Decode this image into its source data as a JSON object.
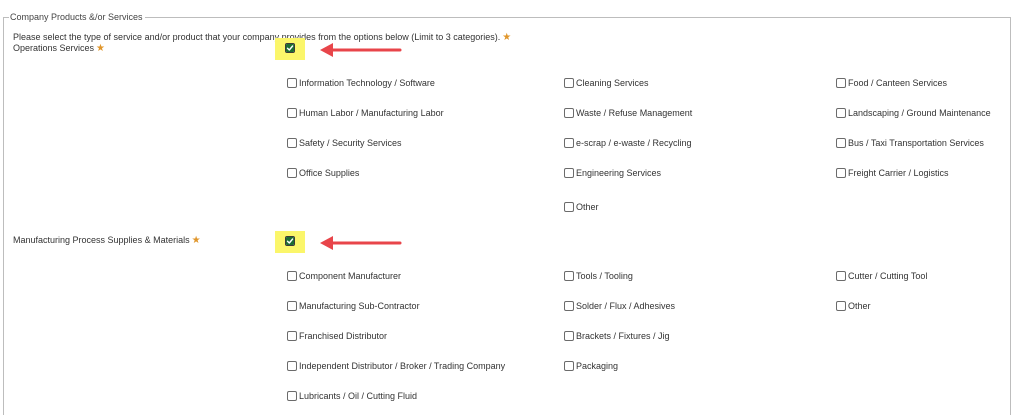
{
  "section": {
    "legend": "Company Products &/or Services",
    "instructions": "Please select the type of service and/or product that your company provides from the options below (Limit to 3 categories).",
    "required_marker": "★"
  },
  "groups": [
    {
      "label": "Operations Services",
      "checked": true,
      "options": [
        [
          "Information Technology / Software",
          "Cleaning Services",
          "Food / Canteen Services"
        ],
        [
          "Human Labor / Manufacturing Labor",
          "Waste / Refuse Management",
          "Landscaping / Ground Maintenance"
        ],
        [
          "Safety / Security Services",
          "e-scrap / e-waste / Recycling",
          "Bus / Taxi Transportation Services"
        ],
        [
          "Office Supplies",
          "Engineering Services",
          "Freight Carrier / Logistics"
        ],
        [
          null,
          "Other",
          null
        ]
      ]
    },
    {
      "label": "Manufacturing Process Supplies & Materials",
      "checked": true,
      "options": [
        [
          "Component Manufacturer",
          "Tools / Tooling",
          "Cutter / Cutting Tool"
        ],
        [
          "Manufacturing Sub-Contractor",
          "Solder / Flux / Adhesives",
          "Other"
        ],
        [
          "Franchised Distributor",
          "Brackets / Fixtures / Jig",
          null
        ],
        [
          "Independent Distributor / Broker / Trading Company",
          "Packaging",
          null
        ],
        [
          "Lubricants / Oil / Cutting Fluid",
          null,
          null
        ]
      ]
    }
  ],
  "colors": {
    "highlight": "#fbf66a",
    "checkbox_fill": "#1c6d33",
    "arrow": "#e8454a",
    "required_star": "#e0962b",
    "border": "#bdbdbd"
  },
  "icons": {
    "checkmark": "check-icon",
    "arrow": "arrow-left-icon"
  }
}
